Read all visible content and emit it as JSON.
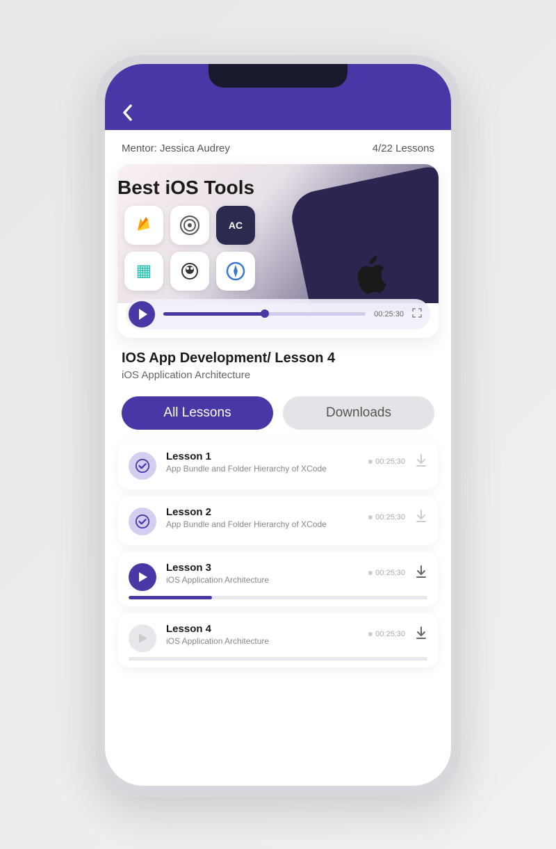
{
  "header": {
    "mentor": "Mentor: Jessica Audrey",
    "progress": "4/22 Lessons"
  },
  "video": {
    "thumbTitle": "Best iOS Tools",
    "time": "00:25:30",
    "progressPercent": 50
  },
  "lesson": {
    "title": "IOS App Development/ Lesson 4",
    "subtitle": "iOS Application Architecture"
  },
  "tabs": {
    "all": "All Lessons",
    "downloads": "Downloads"
  },
  "lessons": [
    {
      "num": "Lesson 1",
      "desc": "App Bundle and Folder Hierarchy of XCode",
      "duration": "00:25:30",
      "status": "done",
      "downloadable": false,
      "progress": null
    },
    {
      "num": "Lesson 2",
      "desc": "App Bundle and Folder Hierarchy of XCode",
      "duration": "00:25:30",
      "status": "done",
      "downloadable": false,
      "progress": null
    },
    {
      "num": "Lesson 3",
      "desc": "iOS Application Architecture",
      "duration": "00:25:30",
      "status": "playing",
      "downloadable": true,
      "progress": 28
    },
    {
      "num": "Lesson 4",
      "desc": "iOS Application Architecture",
      "duration": "00:25:30",
      "status": "idle",
      "downloadable": true,
      "progress": 0
    }
  ]
}
